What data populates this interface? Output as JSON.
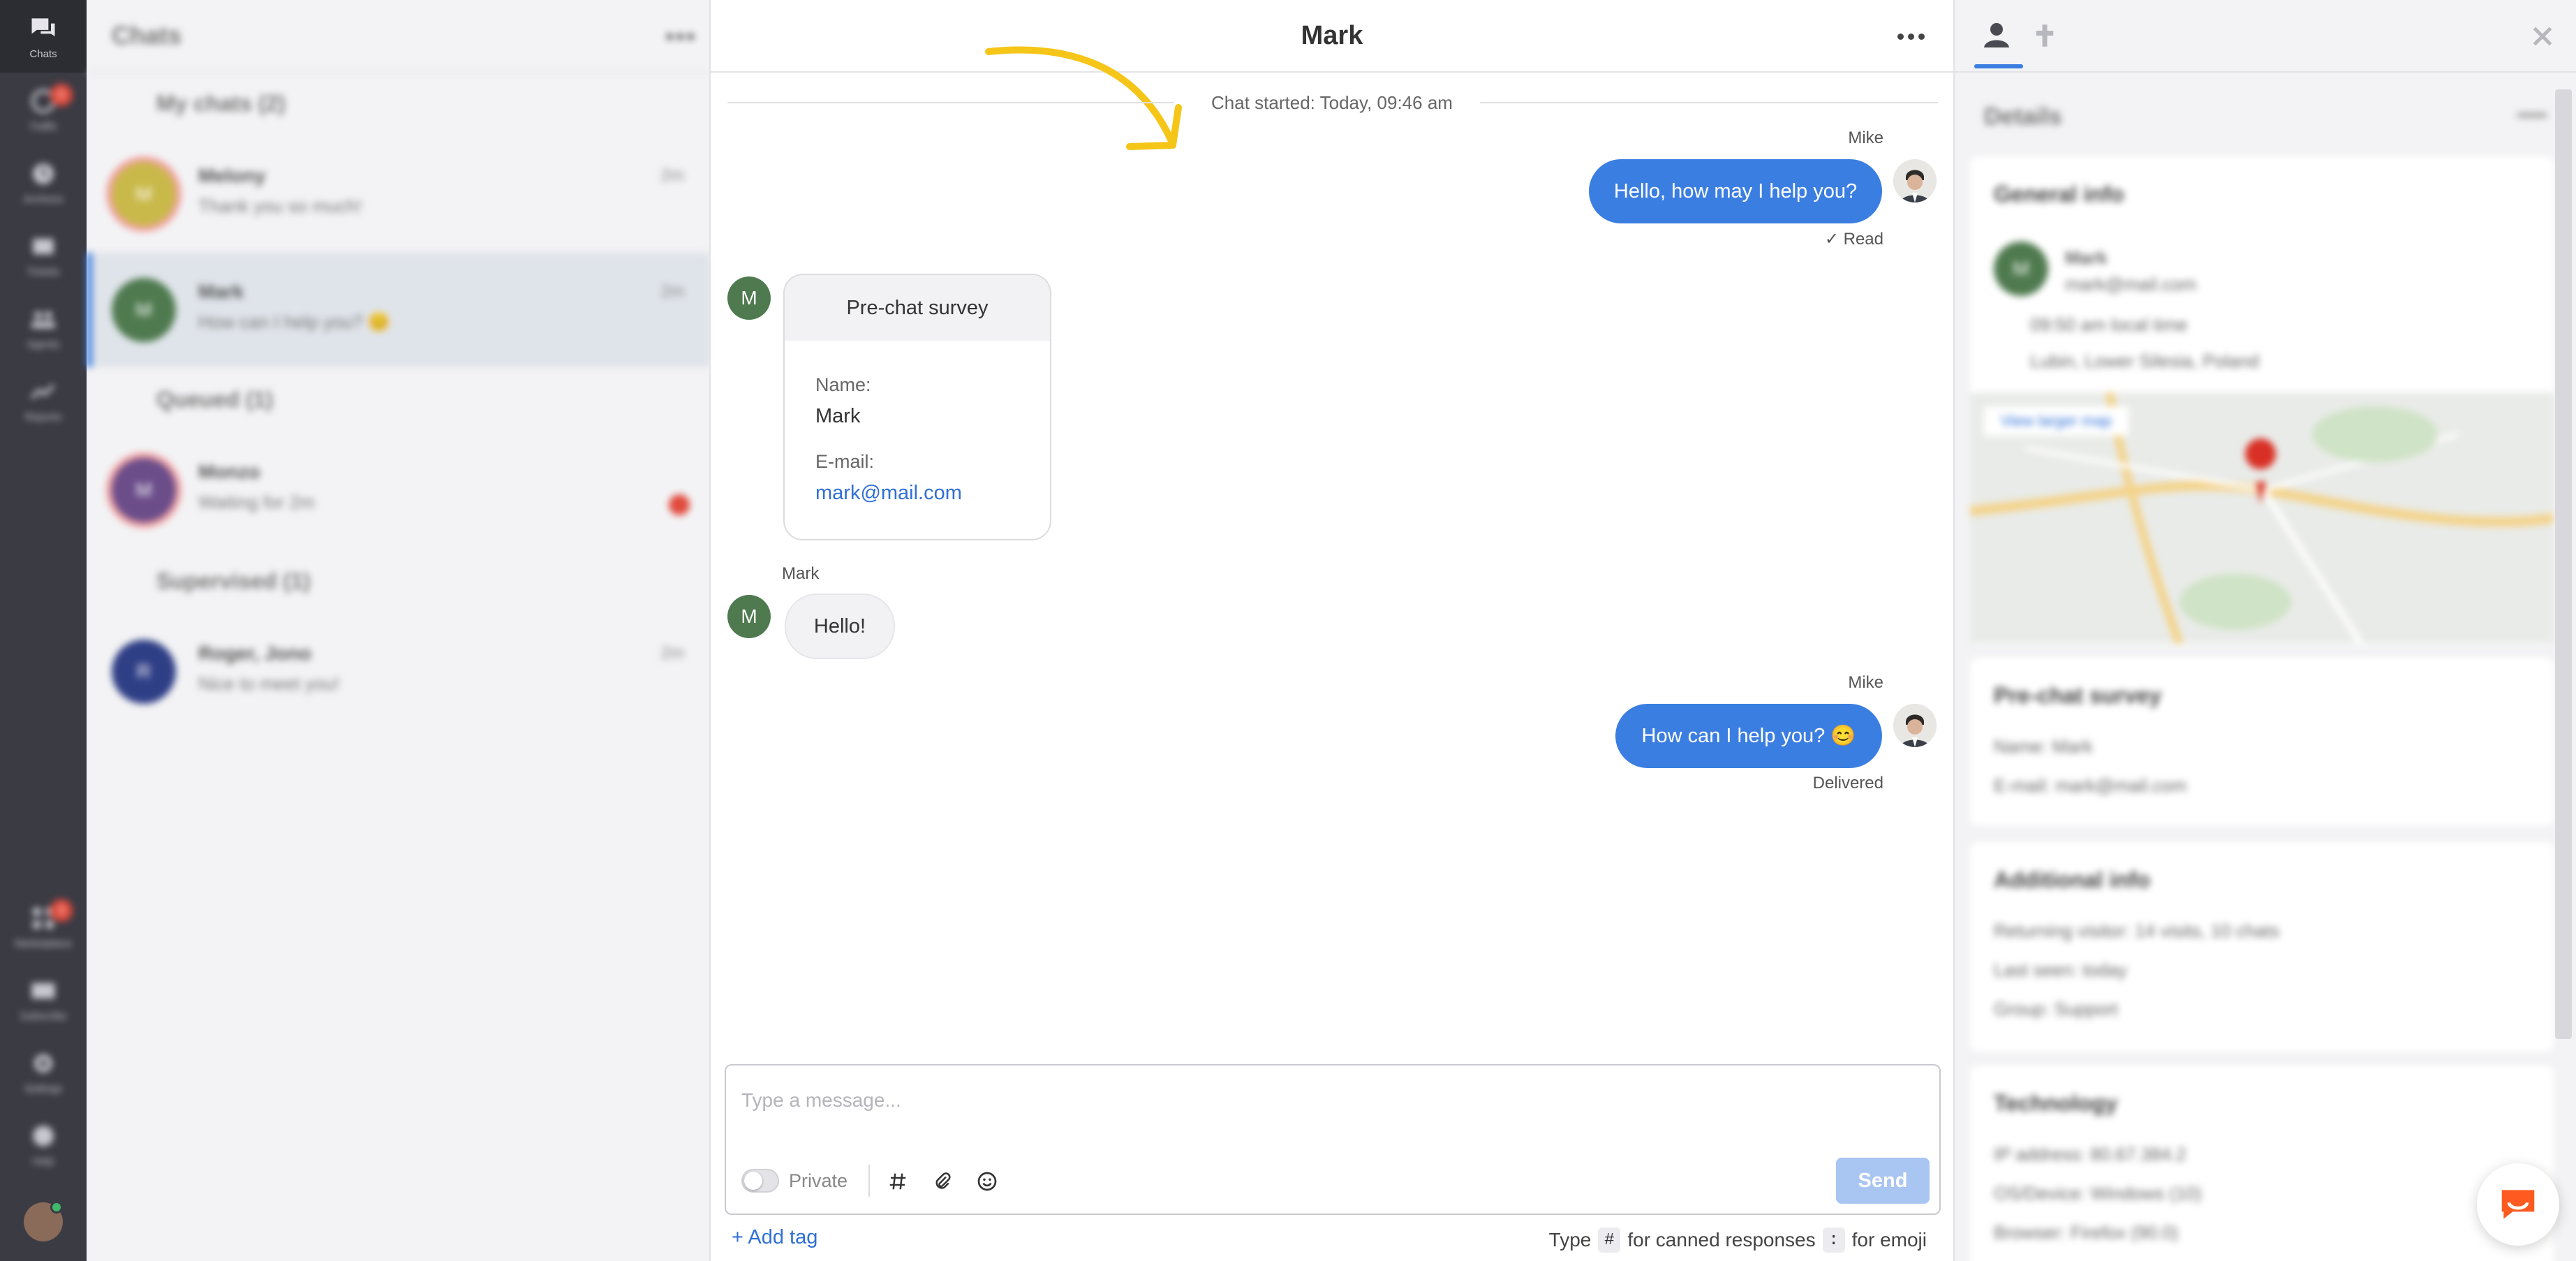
{
  "nav": {
    "items": [
      {
        "label": "Chats",
        "icon": "chat-bubbles-icon"
      },
      {
        "label": "Traffic",
        "icon": "traffic-icon",
        "badge": "5"
      },
      {
        "label": "Archives",
        "icon": "clock-icon"
      },
      {
        "label": "Tickets",
        "icon": "ticket-icon"
      },
      {
        "label": "Agents",
        "icon": "agents-icon"
      },
      {
        "label": "Reports",
        "icon": "chart-icon"
      }
    ],
    "bottom_items": [
      {
        "label": "Marketplace",
        "icon": "grid-icon",
        "badge": "3"
      },
      {
        "label": "Subscribe",
        "icon": "card-icon"
      },
      {
        "label": "Settings",
        "icon": "gear-icon"
      },
      {
        "label": "Help",
        "icon": "help-icon"
      }
    ]
  },
  "chatlist": {
    "title": "Chats",
    "sections": [
      {
        "title": "My chats (2)"
      },
      {
        "title": "Queued (1)"
      },
      {
        "title": "Supervised (1)"
      }
    ],
    "chats": [
      {
        "initial": "M",
        "name": "Melony",
        "preview": "Thank you so much!",
        "time": "2m"
      },
      {
        "initial": "M",
        "name": "Mark",
        "preview": "How can I help you? 😊",
        "time": "2m"
      },
      {
        "initial": "M",
        "name": "Monzo",
        "preview": "Waiting for 2m",
        "time": ""
      },
      {
        "initial": "R",
        "name": "Roger, Jono",
        "preview": "Nice to meet you!",
        "time": "2m"
      }
    ]
  },
  "chat": {
    "title": "Mark",
    "started": "Chat started: Today, 09:46 am",
    "messages": {
      "agent_name_1": "Mike",
      "msg1": "Hello, how may I help you?",
      "msg1_status": "✓ Read",
      "survey_title": "Pre-chat survey",
      "survey_name_label": "Name:",
      "survey_name_value": "Mark",
      "survey_email_label": "E-mail:",
      "survey_email_value": "mark@mail.com",
      "customer_initial": "M",
      "customer_name": "Mark",
      "msg2": "Hello!",
      "agent_name_2": "Mike",
      "msg3": "How can I help you? 😊",
      "msg3_status": "Delivered"
    },
    "composer": {
      "placeholder": "Type a message...",
      "private_label": "Private",
      "send_label": "Send",
      "add_tag": "+ Add tag",
      "hint_type": "Type",
      "hint_hash": "#",
      "hint_canned": "for canned responses",
      "hint_colon": ":",
      "hint_emoji": "for emoji"
    }
  },
  "details": {
    "title": "Details",
    "general": {
      "title": "General info",
      "initial": "M",
      "name": "Mark",
      "email": "mark@mail.com",
      "local_time": "09:50 am local time",
      "location": "Lubin, Lower Silesia, Poland",
      "map_link": "View larger map"
    },
    "survey": {
      "title": "Pre-chat survey",
      "name": "Name: Mark",
      "email": "E-mail: mark@mail.com"
    },
    "additional": {
      "title": "Additional info",
      "returning": "Returning visitor: 14 visits, 10 chats",
      "last_seen": "Last seen: today",
      "group": "Group: Support"
    },
    "technology": {
      "title": "Technology",
      "ip": "IP address: 80.67.384.2",
      "os": "OS/Device: Windows (10)",
      "browser": "Browser: Firefox (90.0)"
    }
  },
  "colors": {
    "accent": "#3b7ee1",
    "nav_bg": "#3b3b44",
    "arrow": "#f5c518"
  }
}
